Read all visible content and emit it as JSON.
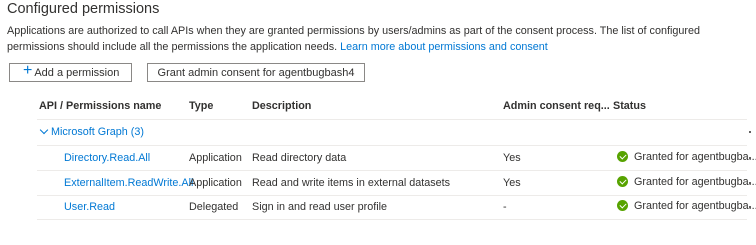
{
  "section": {
    "title": "Configured permissions",
    "description_part1": "Applications are authorized to call APIs when they are granted permissions by users/admins as part of the consent process. The list of configured permissions should include all the permissions the application needs. ",
    "learn_more_link": "Learn more about permissions and consent"
  },
  "toolbar": {
    "add_permission_label": "Add a permission",
    "grant_consent_label": "Grant admin consent for agentbugbash4"
  },
  "table": {
    "headers": {
      "api": "API / Permissions name",
      "type": "Type",
      "description": "Description",
      "admin_consent": "Admin consent req...",
      "status": "Status"
    },
    "group": {
      "label": "Microsoft Graph (3)"
    },
    "rows": [
      {
        "name": "Directory.Read.All",
        "type": "Application",
        "description": "Read directory data",
        "admin_consent": "Yes",
        "status": "Granted for agentbugba..."
      },
      {
        "name": "ExternalItem.ReadWrite.All",
        "type": "Application",
        "description": "Read and write items in external datasets",
        "admin_consent": "Yes",
        "status": "Granted for agentbugba..."
      },
      {
        "name": "User.Read",
        "type": "Delegated",
        "description": "Sign in and read user profile",
        "admin_consent": "-",
        "status": "Granted for agentbugba..."
      }
    ]
  },
  "icons": {
    "add": "plus-icon",
    "expand": "chevron-down-icon",
    "granted": "checkmark-circle-icon",
    "more": "more-options-icon"
  },
  "colors": {
    "link": "#0078d4",
    "granted": "#57a300",
    "text": "#323130"
  }
}
